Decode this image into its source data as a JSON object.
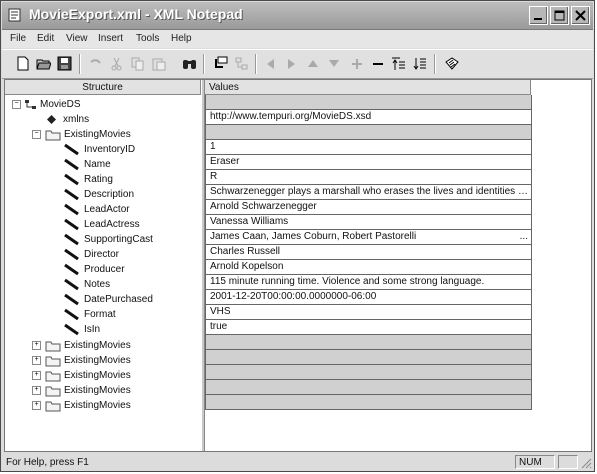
{
  "window": {
    "title": "MovieExport.xml - XML Notepad"
  },
  "menu": [
    "File",
    "Edit",
    "View",
    "Insert",
    "Tools",
    "Help"
  ],
  "columns": {
    "structure": "Structure",
    "values": "Values"
  },
  "tree": {
    "root": "MovieDS",
    "xmlns": "xmlns",
    "group": "ExistingMovies",
    "fields": [
      "InventoryID",
      "Name",
      "Rating",
      "Description",
      "LeadActor",
      "LeadActress",
      "SupportingCast",
      "Director",
      "Producer",
      "Notes",
      "DatePurchased",
      "Format",
      "IsIn"
    ],
    "collapsed": [
      "ExistingMovies",
      "ExistingMovies",
      "ExistingMovies",
      "ExistingMovies",
      "ExistingMovies"
    ]
  },
  "values": {
    "xmlns": "http://www.tempuri.org/MovieDS.xsd",
    "fields": [
      "1",
      "Eraser",
      "R",
      "Schwarzenegger plays a marshall who erases the lives and identities of ...",
      "Arnold Schwarzenegger",
      "Vanessa Williams",
      "James Caan, James Coburn, Robert Pastorelli",
      "Charles Russell",
      "Arnold Kopelson",
      "115 minute running time. Violence and some strong language.",
      "2001-12-20T00:00:00.0000000-06:00",
      "VHS",
      "true"
    ],
    "supporting_more": "..."
  },
  "status": {
    "text": "For Help, press F1",
    "num": "NUM"
  }
}
